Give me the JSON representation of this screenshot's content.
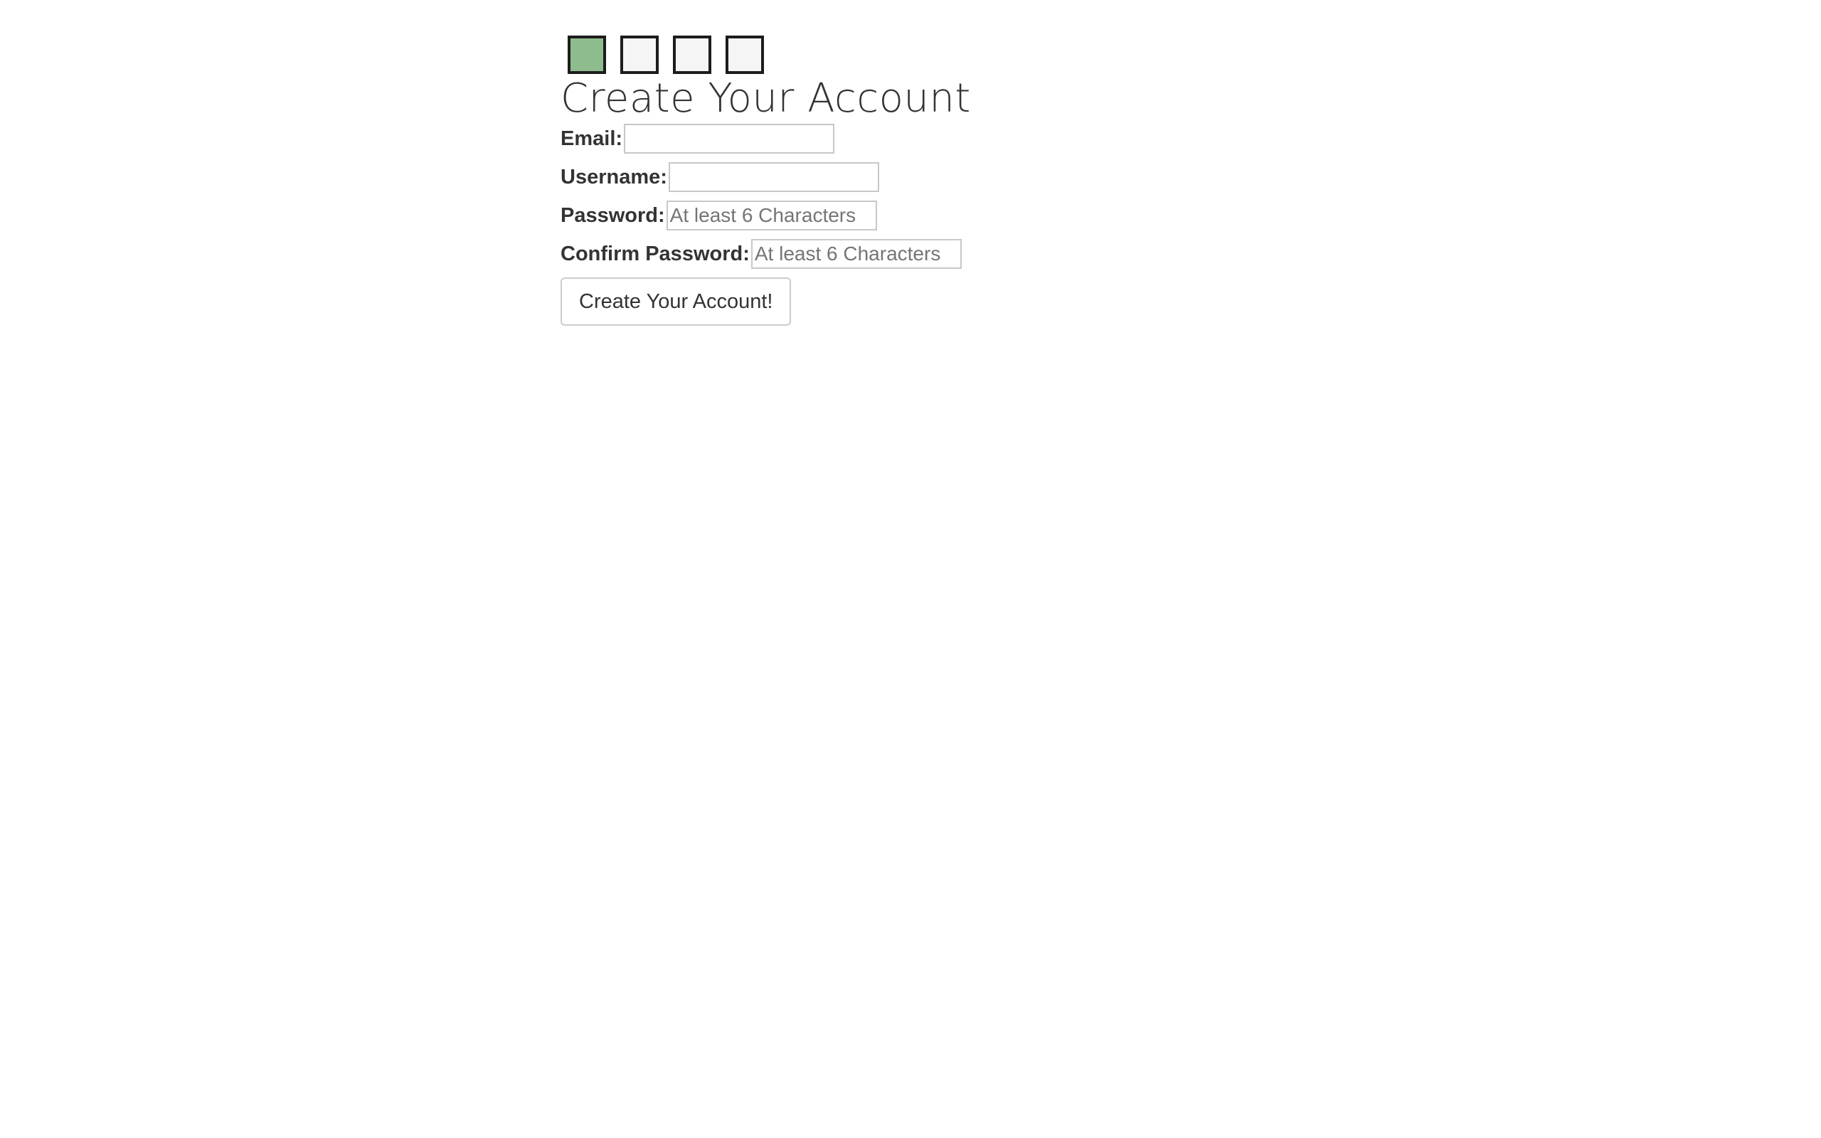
{
  "progress": {
    "steps": [
      {
        "state": "active",
        "color": "#8fbc8f"
      },
      {
        "state": "inactive",
        "color": "#f5f5f5"
      },
      {
        "state": "inactive",
        "color": "#f5f5f5"
      },
      {
        "state": "inactive",
        "color": "#f5f5f5"
      }
    ],
    "current_step": 1,
    "total_steps": 4
  },
  "form": {
    "title": "Create Your Account",
    "email": {
      "label": "Email:",
      "value": "",
      "placeholder": ""
    },
    "username": {
      "label": "Username:",
      "value": "",
      "placeholder": ""
    },
    "password": {
      "label": "Password:",
      "value": "",
      "placeholder": "At least 6 Characters"
    },
    "confirm_password": {
      "label": "Confirm Password:",
      "value": "",
      "placeholder": "At least 6 Characters"
    },
    "submit_label": "Create Your Account!"
  }
}
